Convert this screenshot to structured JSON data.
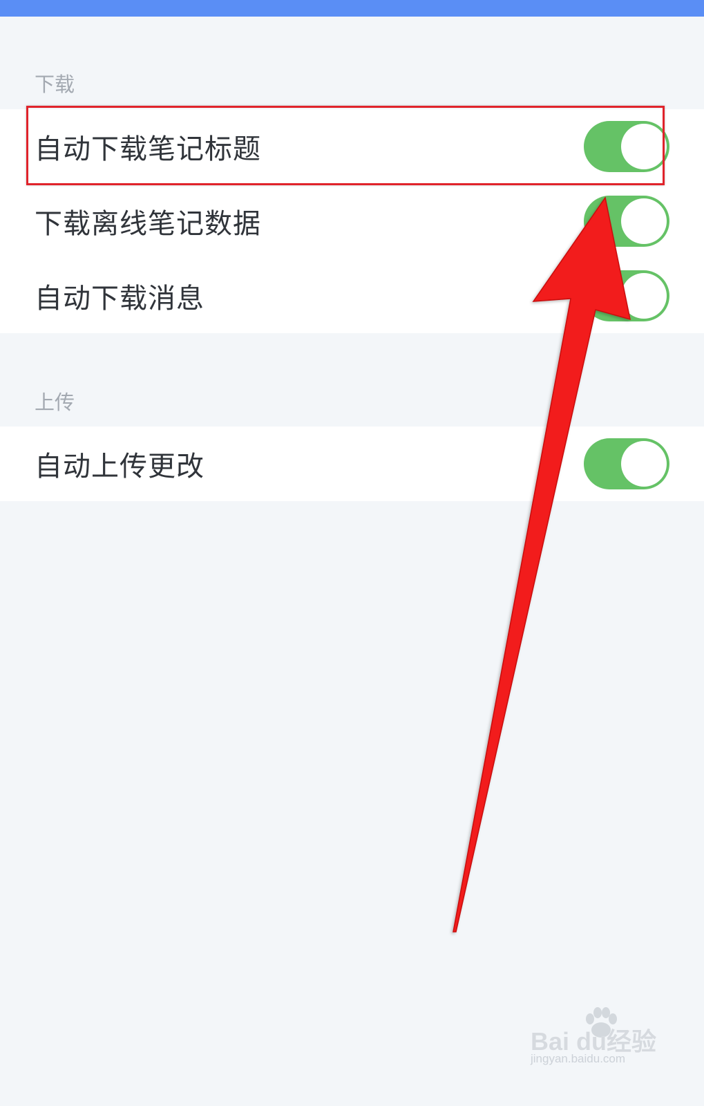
{
  "colors": {
    "top_bar": "#5a8ef5",
    "background": "#f3f6f9",
    "toggle_on": "#65c266",
    "annotation_red": "#e0232b"
  },
  "sections": [
    {
      "header": "下载",
      "items": [
        {
          "label": "自动下载笔记标题",
          "toggle": "on"
        },
        {
          "label": "下载离线笔记数据",
          "toggle": "on"
        },
        {
          "label": "自动下载消息",
          "toggle": "on"
        }
      ]
    },
    {
      "header": "上传",
      "items": [
        {
          "label": "自动上传更改",
          "toggle": "on"
        }
      ]
    }
  ],
  "watermark": {
    "brand": "Bai  du经验",
    "url": "jingyan.baidu.com"
  }
}
